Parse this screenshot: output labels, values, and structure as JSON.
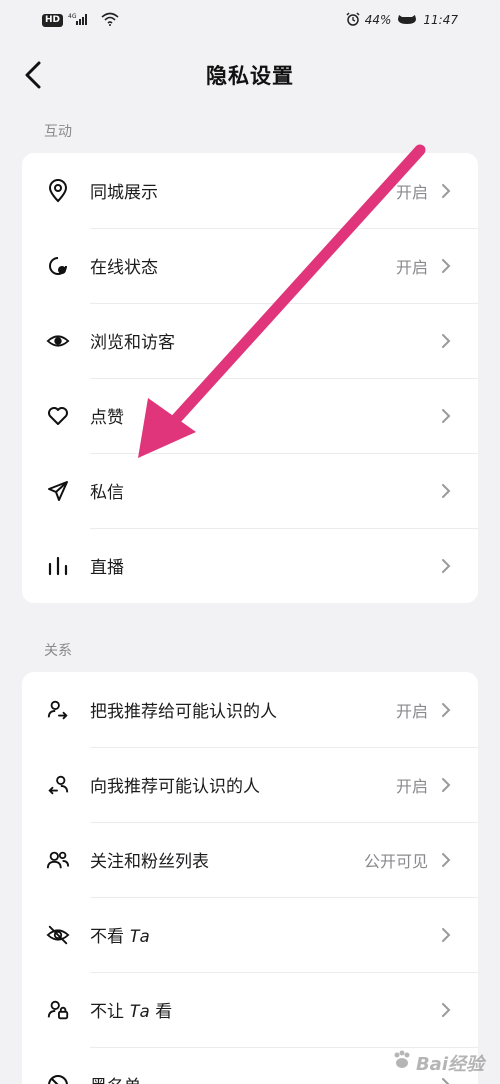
{
  "status_bar": {
    "network": "HD",
    "signal_label": "4G",
    "battery": "44%",
    "time": "11:47"
  },
  "nav": {
    "title": "隐私设置"
  },
  "sections": {
    "interaction": {
      "label": "互动",
      "items": [
        {
          "icon": "location-pin-icon",
          "label": "同城展示",
          "value": "开启"
        },
        {
          "icon": "online-status-icon",
          "label": "在线状态",
          "value": "开启"
        },
        {
          "icon": "eye-icon",
          "label": "浏览和访客",
          "value": ""
        },
        {
          "icon": "heart-icon",
          "label": "点赞",
          "value": ""
        },
        {
          "icon": "paper-plane-icon",
          "label": "私信",
          "value": ""
        },
        {
          "icon": "live-bars-icon",
          "label": "直播",
          "value": ""
        }
      ]
    },
    "relations": {
      "label": "关系",
      "items": [
        {
          "icon": "user-share-icon",
          "label": "把我推荐给可能认识的人",
          "value": "开启"
        },
        {
          "icon": "user-recommend-icon",
          "label": "向我推荐可能认识的人",
          "value": "开启"
        },
        {
          "icon": "users-icon",
          "label": "关注和粉丝列表",
          "value": "公开可见"
        },
        {
          "icon": "eye-off-icon",
          "label_pre": "不看 ",
          "label_ta": "Ta",
          "label_post": "",
          "value": ""
        },
        {
          "icon": "user-lock-icon",
          "label_pre": "不让 ",
          "label_ta": "Ta",
          "label_post": " 看",
          "value": ""
        },
        {
          "icon": "block-icon",
          "label": "黑名单",
          "value": ""
        }
      ]
    }
  },
  "watermark": {
    "text": "Bai经验"
  },
  "colors": {
    "background": "#f2f2f4",
    "card": "#ffffff",
    "annotation_arrow": "#e0357a",
    "secondary_text": "#8a8a8e"
  }
}
